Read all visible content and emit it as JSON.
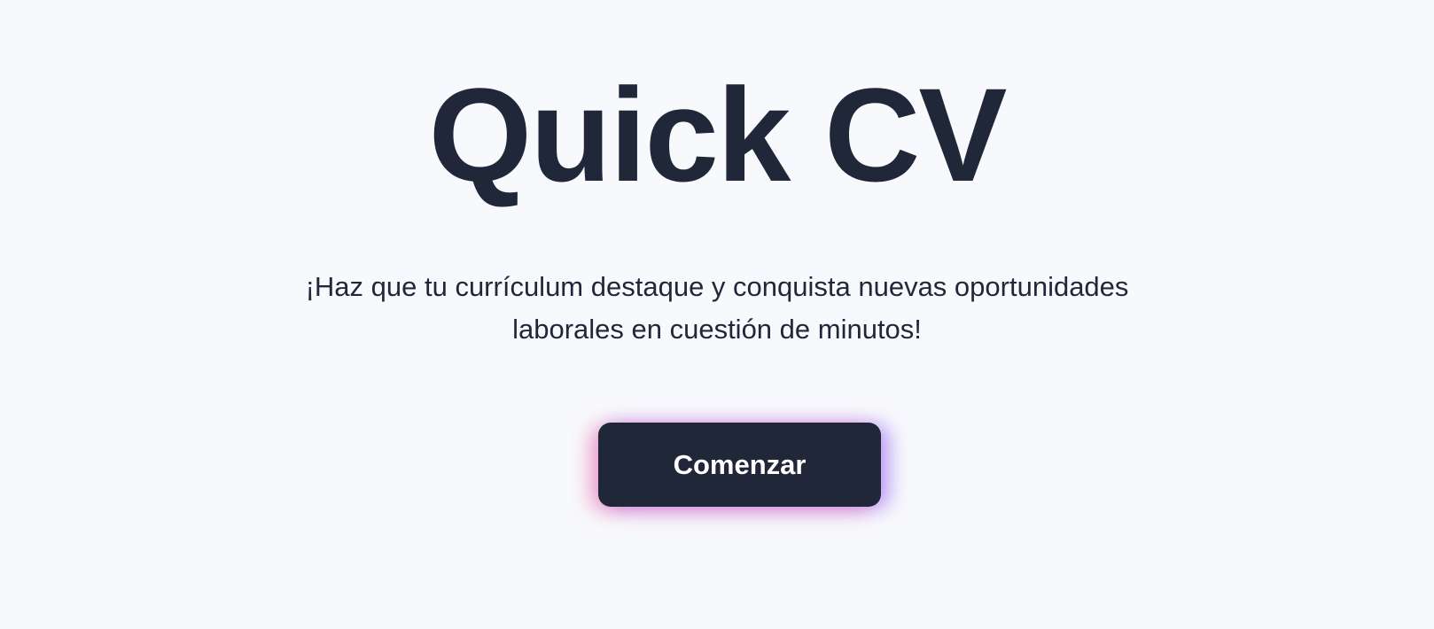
{
  "hero": {
    "title": "Quick CV",
    "subtitle": "¡Haz que tu currículum destaque y conquista nuevas oportunidades laborales en cuestión de minutos!"
  },
  "cta": {
    "label": "Comenzar"
  },
  "colors": {
    "background": "#f8f9fc",
    "text": "#1f2739",
    "button_bg": "#1f2739",
    "button_text": "#ffffff",
    "glow_pink": "#ec4899",
    "glow_purple": "#8b5cf6"
  }
}
